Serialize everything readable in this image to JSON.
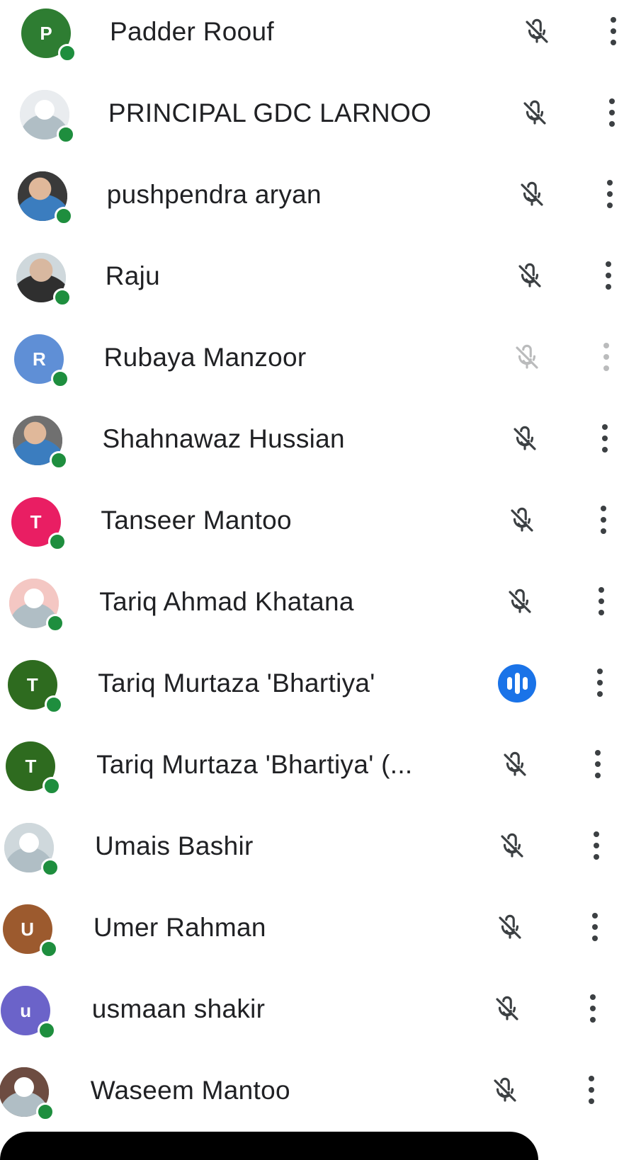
{
  "participants": [
    {
      "name": "Padder Roouf",
      "avatar_letter": "P",
      "avatar_color": "#2e7d32",
      "mic": "muted",
      "online": true
    },
    {
      "name": "PRINCIPAL GDC LARNOO",
      "avatar_letter": "",
      "avatar_color": "#e9ecef",
      "mic": "muted",
      "online": true
    },
    {
      "name": "pushpendra aryan",
      "avatar_letter": "",
      "avatar_color": "#3a3a3a",
      "mic": "muted",
      "online": true
    },
    {
      "name": "Raju",
      "avatar_letter": "",
      "avatar_color": "#cfd8dc",
      "mic": "muted",
      "online": true
    },
    {
      "name": "Rubaya Manzoor",
      "avatar_letter": "R",
      "avatar_color": "#5f8fd6",
      "mic": "muted",
      "online": true
    },
    {
      "name": "Shahnawaz Hussian",
      "avatar_letter": "",
      "avatar_color": "#707070",
      "mic": "muted",
      "online": true
    },
    {
      "name": "Tanseer Mantoo",
      "avatar_letter": "T",
      "avatar_color": "#e91e63",
      "mic": "muted",
      "online": true
    },
    {
      "name": "Tariq Ahmad Khatana",
      "avatar_letter": "",
      "avatar_color": "#f4c7c3",
      "mic": "muted",
      "online": true
    },
    {
      "name": "Tariq Murtaza 'Bhartiya'",
      "avatar_letter": "T",
      "avatar_color": "#2e6b1f",
      "mic": "speaking",
      "online": true
    },
    {
      "name": "Tariq Murtaza 'Bhartiya' (...",
      "avatar_letter": "T",
      "avatar_color": "#2e6b1f",
      "mic": "muted",
      "online": true
    },
    {
      "name": "Umais Bashir",
      "avatar_letter": "",
      "avatar_color": "#cfd8dc",
      "mic": "muted",
      "online": true
    },
    {
      "name": "Umer Rahman",
      "avatar_letter": "U",
      "avatar_color": "#9c5a2e",
      "mic": "muted",
      "online": true
    },
    {
      "name": "usmaan shakir",
      "avatar_letter": "u",
      "avatar_color": "#6b63c9",
      "mic": "muted",
      "online": true
    },
    {
      "name": "Waseem Mantoo",
      "avatar_letter": "",
      "avatar_color": "#6d4c41",
      "mic": "muted",
      "online": true
    }
  ],
  "icons": {
    "mute": "mic-off-icon",
    "speaking": "speaking-indicator-icon",
    "more": "more-options-icon"
  },
  "colors": {
    "presence": "#1e8e3e",
    "speaking": "#1a73e8",
    "text": "#202124"
  }
}
